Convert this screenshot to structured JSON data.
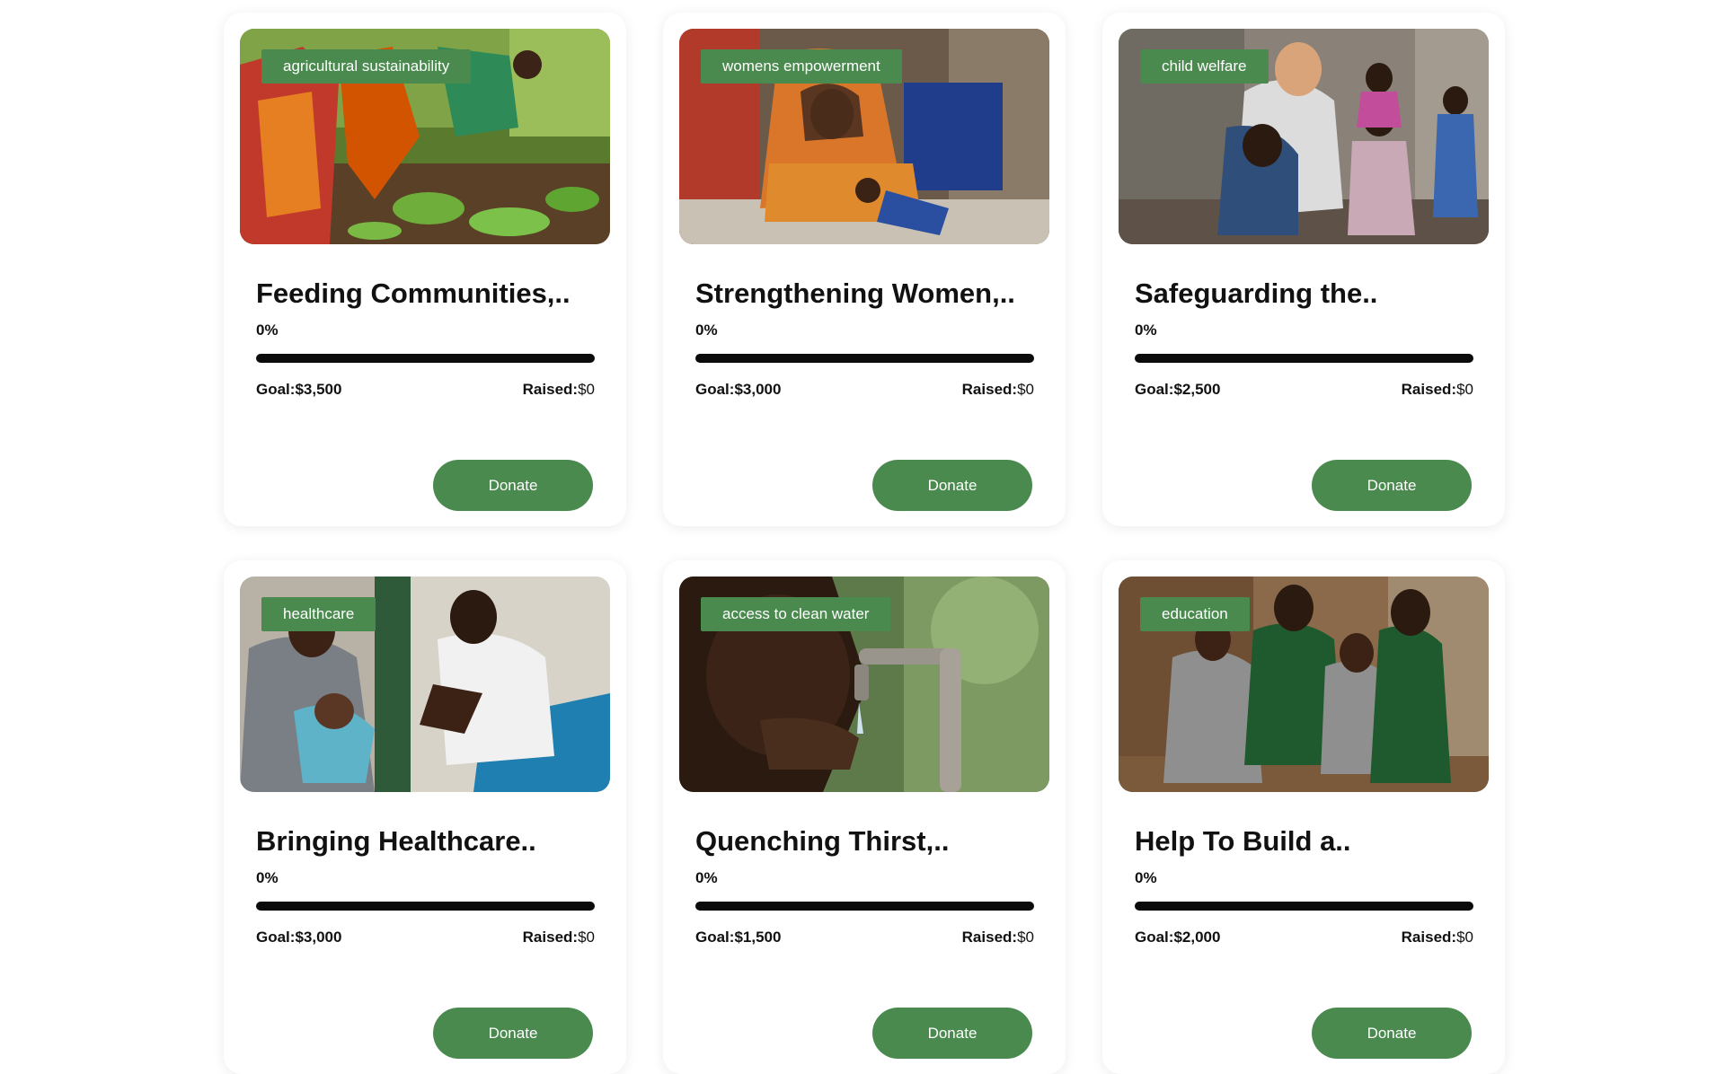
{
  "colors": {
    "accent": "#4a8a4f",
    "bar_track": "#0b0b0b",
    "card_bg": "#ffffff"
  },
  "cards": [
    {
      "tag": "agricultural sustainability",
      "title": "Feeding Communities,..",
      "progress_label": "0%",
      "progress_fraction": 0,
      "goal_label": "Goal:",
      "goal_value": "$3,500",
      "raised_label": "Raised:",
      "raised_value": "$0",
      "button": "Donate",
      "image_subject": "women farming crops"
    },
    {
      "tag": "womens empowerment",
      "title": "Strengthening Women,..",
      "progress_label": "0%",
      "progress_fraction": 0,
      "goal_label": "Goal:",
      "goal_value": "$3,000",
      "raised_label": "Raised:",
      "raised_value": "$0",
      "button": "Donate",
      "image_subject": "woman sewing"
    },
    {
      "tag": "child welfare",
      "title": "Safeguarding the..",
      "progress_label": "0%",
      "progress_fraction": 0,
      "goal_label": "Goal:",
      "goal_value": "$2,500",
      "raised_label": "Raised:",
      "raised_value": "$0",
      "button": "Donate",
      "image_subject": "volunteer hugging children"
    },
    {
      "tag": "healthcare",
      "title": "Bringing Healthcare..",
      "progress_label": "0%",
      "progress_fraction": 0,
      "goal_label": "Goal:",
      "goal_value": "$3,000",
      "raised_label": "Raised:",
      "raised_value": "$0",
      "button": "Donate",
      "image_subject": "nurse examining baby"
    },
    {
      "tag": "access to clean water",
      "title": "Quenching Thirst,..",
      "progress_label": "0%",
      "progress_fraction": 0,
      "goal_label": "Goal:",
      "goal_value": "$1,500",
      "raised_label": "Raised:",
      "raised_value": "$0",
      "button": "Donate",
      "image_subject": "child drinking from tap"
    },
    {
      "tag": "education",
      "title": "Help To Build a..",
      "progress_label": "0%",
      "progress_fraction": 0,
      "goal_label": "Goal:",
      "goal_value": "$2,000",
      "raised_label": "Raised:",
      "raised_value": "$0",
      "button": "Donate",
      "image_subject": "schoolchildren thumbs up"
    }
  ]
}
